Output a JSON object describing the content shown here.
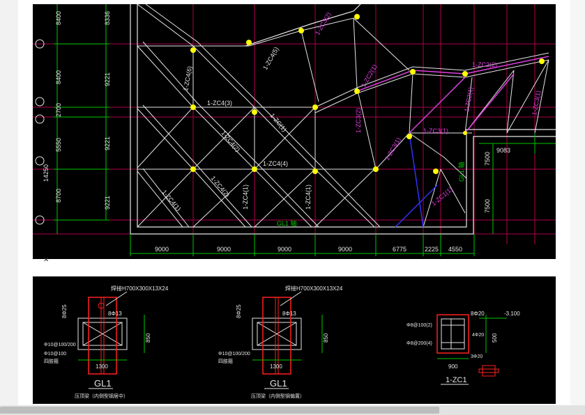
{
  "plan": {
    "left_dims": [
      "8400",
      "8400",
      "2700",
      "5550",
      "14250",
      "8700"
    ],
    "left_dims2": [
      "8336",
      "9221",
      "9221",
      "9221"
    ],
    "bottom_dims": [
      "9000",
      "9000",
      "9000",
      "9000",
      "6775",
      "2225",
      "4550"
    ],
    "right_dims": [
      "9083",
      "7500",
      "7500"
    ],
    "member_labels": [
      "1-ZC4(6)",
      "1-ZC4(3)",
      "1-ZC4(5)",
      "1-ZC4(2)",
      "1-ZC4(4)",
      "1-ZC4(2)",
      "1-ZC4(1)",
      "1-ZC4(1)",
      "1-ZC4(1)",
      "1-ZC(1)",
      "1-ZC3(2)",
      "1-ZC2(1)",
      "1-ZC3(1)",
      "1-ZC2(2)",
      "1-ZC2(1)",
      "1-ZC1(1)",
      "1-ZC3(1)",
      "1-ZC3(2)",
      "1-ZC3(1)"
    ],
    "beam_label": "GL1 轴",
    "axis_label": "GL1 轴",
    "colors": {
      "grid": "#b0004a",
      "member": "#e6e6e6",
      "accent": "#ffff00",
      "dim": "#00c800",
      "magenta": "#e040e0",
      "blue": "#3030ff"
    }
  },
  "details": {
    "section1": {
      "steel": "焊接H700X300X13X24",
      "dim_top": "8Φ25",
      "stirrup1": "Φ10@100/200",
      "stirrup2": "Φ10@100",
      "label_extra": "四肢箍",
      "bar": "8Φ13",
      "height": "850",
      "width": "1300",
      "title": "GL1",
      "caption": "压顶梁（内侧型钢居中）"
    },
    "section2": {
      "steel": "焊接H700X300X13X24",
      "dim_top": "8Φ25",
      "stirrup1": "Φ10@100/200",
      "label_extra": "四肢箍",
      "bar": "8Φ13",
      "height": "850",
      "width": "1300",
      "title": "GL1",
      "caption": "压顶梁（内侧型钢偏置）"
    },
    "section3": {
      "bar_top": "8Φ20",
      "elev": "-3.100",
      "stirrup1": "Φ8@100(2)",
      "stirrup2": "Φ8@200(4)",
      "mid_bar": "4Φ20",
      "height": "500",
      "bot_bar": "3Φ20",
      "width": "900",
      "title": "1-ZC1"
    }
  }
}
